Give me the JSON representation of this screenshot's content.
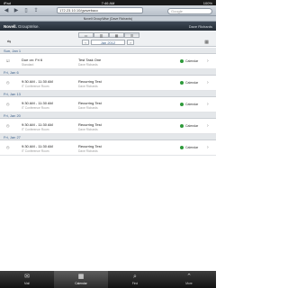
{
  "status": {
    "carrier": "iPad",
    "time": "7:46 AM",
    "battery": "100%"
  },
  "browser": {
    "url": "172.23.10.10/gwwebacc",
    "search_placeholder": "Google",
    "page_title": "Novell GroupWise (Dave Richards)"
  },
  "brand": {
    "name": "Novell.",
    "product": "GroupWise.",
    "user": "Dave Richards"
  },
  "nav": {
    "month": "Jan 2012",
    "prev": "‹",
    "next": "›"
  },
  "days": [
    {
      "header": "Sun, Jan 1",
      "items": [
        {
          "time": "Due on: Fri 6",
          "sub": "Standard",
          "title": "Test Task One",
          "org": "Dave Richards",
          "cal": "Calendar",
          "icon": "task-icon"
        }
      ]
    },
    {
      "header": "Fri, Jan 6",
      "items": [
        {
          "time": "9:30 AM - 11:30 AM",
          "sub": "IT Conference Room",
          "title": "Recurring Test",
          "org": "Dave Richards",
          "cal": "Calendar",
          "icon": "appointment-icon"
        }
      ]
    },
    {
      "header": "Fri, Jan 13",
      "items": [
        {
          "time": "9:30 AM - 11:30 AM",
          "sub": "IT Conference Room",
          "title": "Recurring Test",
          "org": "Dave Richards",
          "cal": "Calendar",
          "icon": "appointment-icon"
        }
      ]
    },
    {
      "header": "Fri, Jan 20",
      "items": [
        {
          "time": "9:30 AM - 11:30 AM",
          "sub": "IT Conference Room",
          "title": "Recurring Test",
          "org": "Dave Richards",
          "cal": "Calendar",
          "icon": "appointment-icon"
        }
      ]
    },
    {
      "header": "Fri, Jan 27",
      "items": [
        {
          "time": "9:30 AM - 11:30 AM",
          "sub": "IT Conference Room",
          "title": "Recurring Test",
          "org": "Dave Richards",
          "cal": "Calendar",
          "icon": "appointment-icon"
        }
      ]
    }
  ],
  "tabs": [
    {
      "label": "Mail",
      "icon": "mail-icon"
    },
    {
      "label": "Calendar",
      "icon": "calendar-icon"
    },
    {
      "label": "Find",
      "icon": "find-icon"
    },
    {
      "label": "More",
      "icon": "more-icon"
    }
  ],
  "colors": {
    "calendar_dot": "#2e9a3a",
    "link": "#3a5f8a"
  }
}
